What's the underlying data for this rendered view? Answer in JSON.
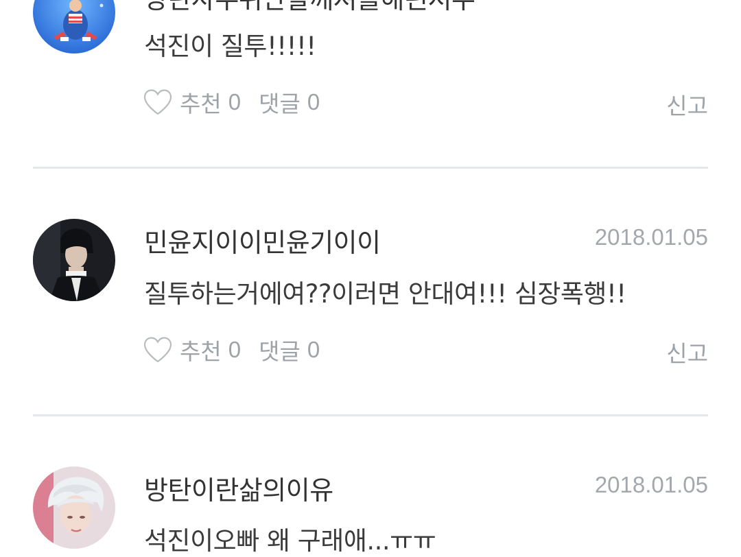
{
  "comments": [
    {
      "author": "방탄사우위만할깨져를해런서우",
      "date": "",
      "text": "석진이 질투!!!!!",
      "like_label": "추천",
      "like_count": "0",
      "reply_label": "댓글",
      "reply_count": "0",
      "report_label": "신고",
      "avatar_icon": "avatar-concert-photo-icon"
    },
    {
      "author": "민윤지이이민윤기이이",
      "date": "2018.01.05",
      "text": "질투하는거에여??이러면 안대여!!! 심장폭행!!",
      "like_label": "추천",
      "like_count": "0",
      "reply_label": "댓글",
      "reply_count": "0",
      "report_label": "신고",
      "avatar_icon": "avatar-dark-portrait-icon"
    },
    {
      "author": "방탄이란삶의이유",
      "date": "2018.01.05",
      "text": "석진이오빠 왜 구래애...ㅠㅠ",
      "avatar_icon": "avatar-silver-hair-portrait-icon"
    }
  ],
  "colors": {
    "muted": "#9ea3a8",
    "date": "#a4a8ad",
    "divider": "#e4e8ea",
    "text": "#3b3b3b"
  }
}
